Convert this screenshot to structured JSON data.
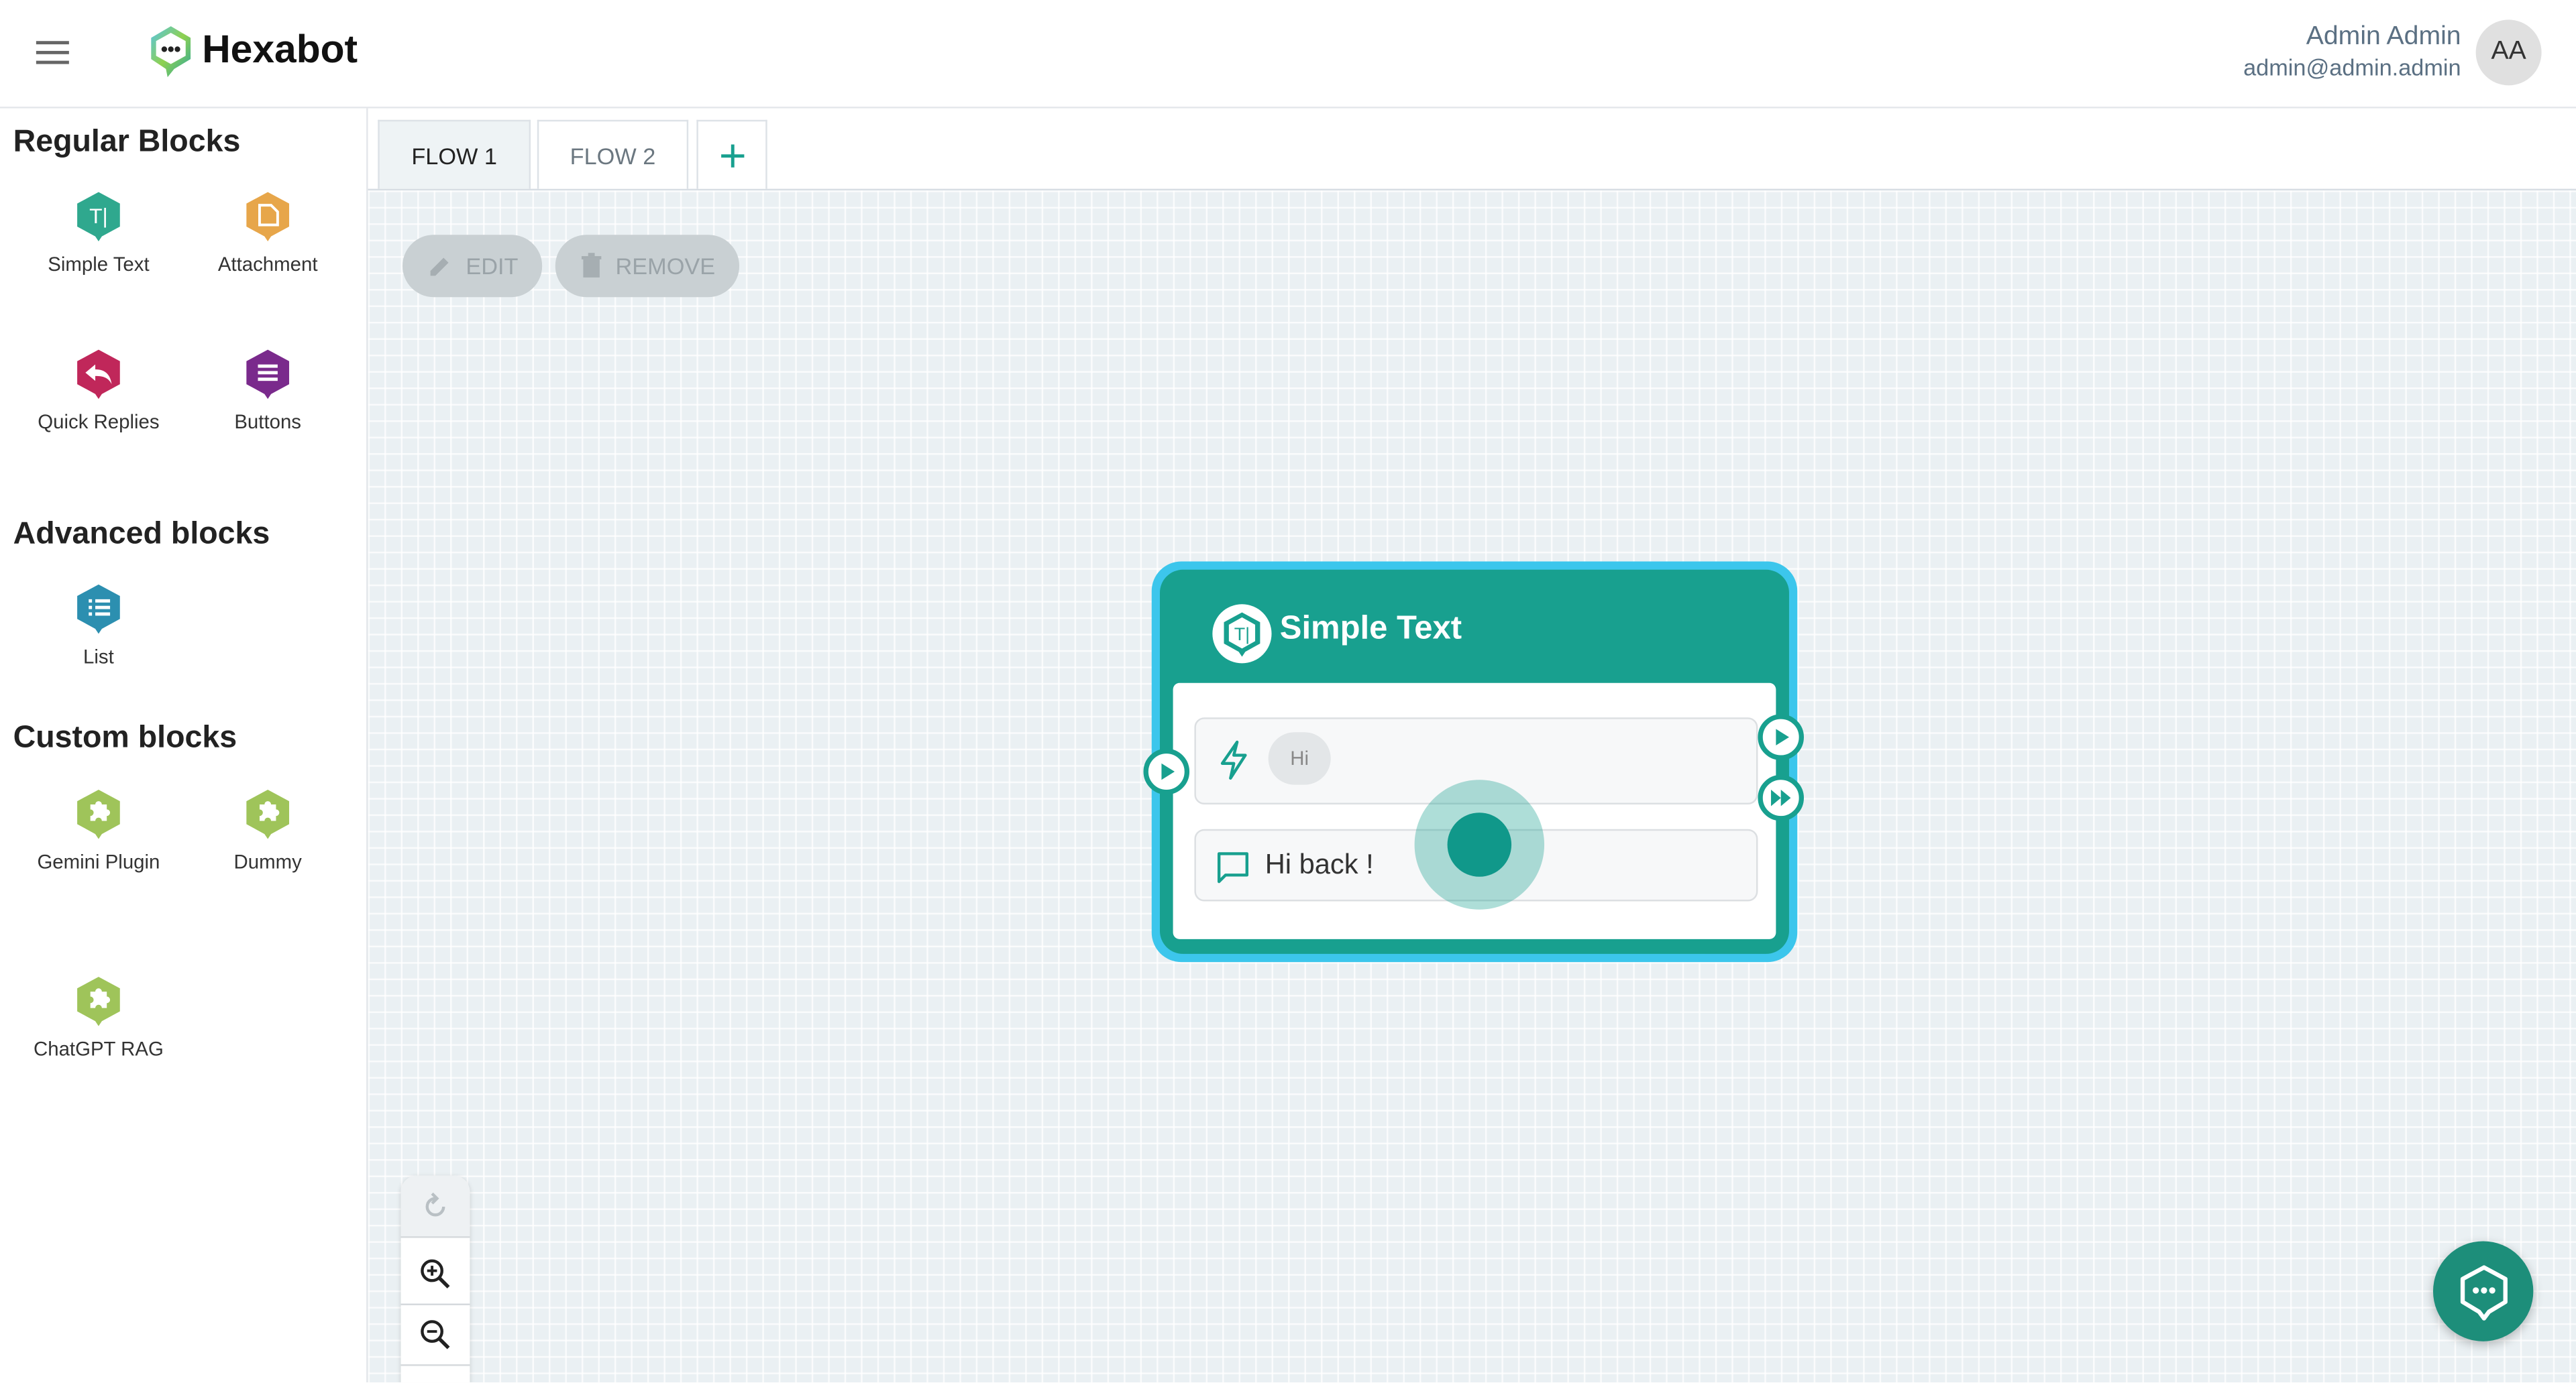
{
  "app": {
    "name": "Hexabot"
  },
  "user": {
    "name": "Admin Admin",
    "email": "admin@admin.admin",
    "initials": "AA"
  },
  "sidebar": {
    "sections": [
      {
        "title": "Regular Blocks",
        "items": [
          {
            "label": "Simple Text",
            "icon": "simple-text-icon",
            "color": "#2fa88e"
          },
          {
            "label": "Attachment",
            "icon": "attachment-icon",
            "color": "#e7a64a"
          },
          {
            "label": "Quick Replies",
            "icon": "quick-replies-icon",
            "color": "#c0275a"
          },
          {
            "label": "Buttons",
            "icon": "buttons-icon",
            "color": "#7a2a8c"
          }
        ]
      },
      {
        "title": "Advanced blocks",
        "items": [
          {
            "label": "List",
            "icon": "list-icon",
            "color": "#2c8fb0"
          }
        ]
      },
      {
        "title": "Custom blocks",
        "items": [
          {
            "label": "Gemini Plugin",
            "icon": "puzzle-icon",
            "color": "#9fc45a"
          },
          {
            "label": "Dummy",
            "icon": "puzzle-icon",
            "color": "#9fc45a"
          },
          {
            "label": "ChatGPT RAG",
            "icon": "puzzle-icon",
            "color": "#9fc45a"
          }
        ]
      }
    ]
  },
  "tabs": [
    {
      "label": "FLOW 1",
      "active": true
    },
    {
      "label": "FLOW 2",
      "active": false
    }
  ],
  "toolbar": {
    "edit_label": "EDIT",
    "remove_label": "REMOVE"
  },
  "node": {
    "title": "Simple Text",
    "trigger_chip": "Hi",
    "message": "Hi back !",
    "header_color": "#18a08f",
    "selection_color": "#3cc6ec"
  },
  "colors": {
    "accent": "#18a08f",
    "fab": "#1d8e7a"
  }
}
